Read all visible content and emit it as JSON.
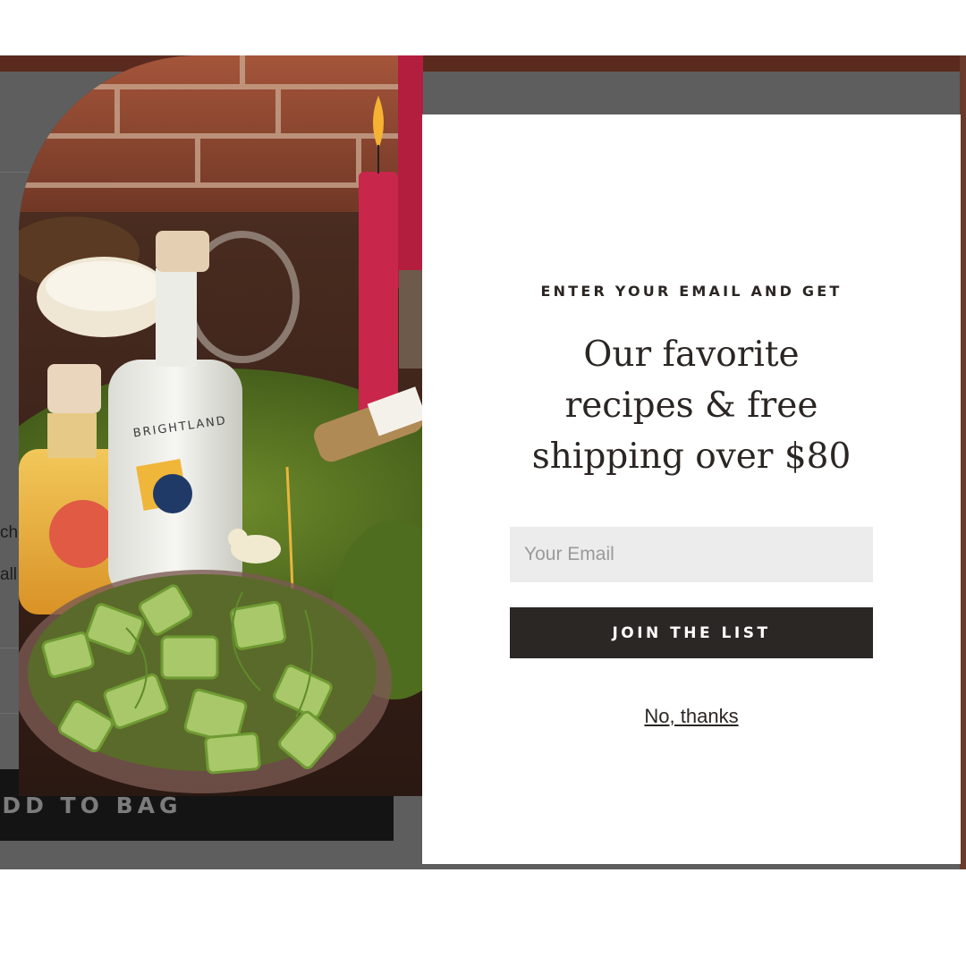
{
  "background_page": {
    "add_to_bag_label": "ADD TO BAG",
    "text_fragment_1": "ch",
    "text_fragment_2": "all"
  },
  "product_photo": {
    "bottle_brand": "BRIGHTLAND"
  },
  "popup": {
    "eyebrow": "ENTER YOUR EMAIL AND GET",
    "headline_line1": "Our favorite",
    "headline_line2": "recipes & free",
    "headline_line3": "shipping over $80",
    "email_placeholder": "Your Email",
    "email_value": "",
    "join_button_label": "JOIN THE LIST",
    "dismiss_link": "No, thanks"
  },
  "colors": {
    "overlay_gray": "#5e5e5e",
    "dark_button": "#2b2725",
    "text_dark": "#2b2623",
    "input_bg": "#ececec",
    "brick_red": "#5b2a1e",
    "candle_red": "#c8264a"
  }
}
